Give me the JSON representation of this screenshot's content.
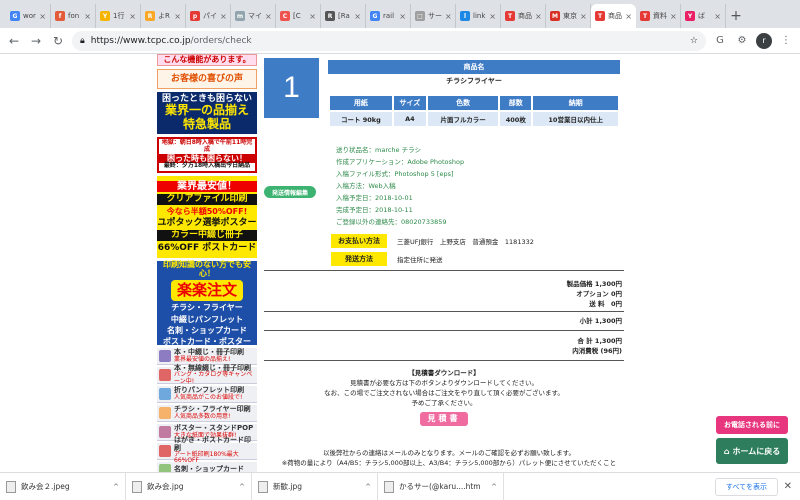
{
  "browser": {
    "tabs": [
      {
        "label": "wor",
        "color": "#4285f4",
        "glyph": "G"
      },
      {
        "label": "fon",
        "color": "#e25c3b",
        "glyph": "f"
      },
      {
        "label": "1行",
        "color": "#f4b400",
        "glyph": "Y"
      },
      {
        "label": "よR",
        "color": "#f9a825",
        "glyph": "R"
      },
      {
        "label": "パイ",
        "color": "#e53935",
        "glyph": "p"
      },
      {
        "label": "マイ",
        "color": "#90a4ae",
        "glyph": "m"
      },
      {
        "label": "[C",
        "color": "#ef5350",
        "glyph": "C"
      },
      {
        "label": "[Ra",
        "color": "#555555",
        "glyph": "R"
      },
      {
        "label": "rail",
        "color": "#4285f4",
        "glyph": "G"
      },
      {
        "label": "サー",
        "color": "#9e9e9e",
        "glyph": "□"
      },
      {
        "label": "link",
        "color": "#1e88e5",
        "glyph": "l"
      },
      {
        "label": "商品",
        "color": "#e53935",
        "glyph": "T"
      },
      {
        "label": "東京",
        "color": "#d93025",
        "glyph": "M"
      },
      {
        "label": "商品",
        "color": "#e53935",
        "glyph": "T",
        "active": true
      },
      {
        "label": "資料",
        "color": "#e53935",
        "glyph": "T"
      },
      {
        "label": "ば",
        "color": "#e91e63",
        "glyph": "Y"
      }
    ],
    "url_host": "https://www.tcpc.co.jp",
    "url_path": "/orders/check",
    "avatar_letter": "r"
  },
  "sidebar": {
    "banner_top": "こんな機能があります。",
    "banner_voice": "お客様の喜びの声",
    "banner_trouble_line1": "困ったときも困らない",
    "banner_trouble_line2": "業界一の品揃え 特急製品",
    "banner_quick_line1": "地獄：朝日8時入稿で午前11時完成",
    "banner_quick_line2": "困った時も困らない！",
    "banner_quick_line3": "最終：夕方18時入稿出今日納品",
    "cheap_line1": "業界最安値！",
    "cheap_line2": "クリアファイル印刷",
    "cheap_line3": "今なら半額50%OFF!",
    "cheap_line4": "ユポタック選挙ポスター",
    "cheap_line5": "カラー中綴じ冊子",
    "cheap_line6": "66%OFF ポストカード",
    "safe_line1": "印刷知識のない方でも安心！",
    "safe_big": "楽楽注文",
    "safe_line2": "チラシ・フライヤー",
    "safe_line3": "中綴じパンフレット",
    "safe_line4": "名刺・ショップカード",
    "safe_line5": "ポストカード・ポスター",
    "items": [
      {
        "title": "本・中綴じ・冊子印刷",
        "sub": "業界最安値の品揃え!",
        "color": "#8e7cc3"
      },
      {
        "title": "本・無線綴じ・冊子印刷",
        "sub": "バング・カタログ等キャンペーン中!",
        "color": "#e06666"
      },
      {
        "title": "折りパンフレット印刷",
        "sub": "人気商品がこのお値段で!",
        "color": "#6fa8dc"
      },
      {
        "title": "チラシ・フライヤー印刷",
        "sub": "人気商品多数の用意!",
        "color": "#f6b26b"
      },
      {
        "title": "ポスター・スタンドPOP",
        "sub": "大きな紙面で効果抜群!",
        "color": "#c27ba0"
      },
      {
        "title": "はがき・ポストカード印刷",
        "sub": "アート紙印刷180%最大66%OFF",
        "color": "#e06666"
      },
      {
        "title": "名刺・ショップカード",
        "sub": "",
        "color": "#93c47d"
      }
    ],
    "addr_edit_label": "発送情報編集"
  },
  "order": {
    "number": "1",
    "product_header": "商品名",
    "product_name": "チラシフライヤー",
    "spec_headers": [
      "用紙",
      "サイズ",
      "色数",
      "部数",
      "納期"
    ],
    "spec_values": [
      "コート 90kg",
      "A4",
      "片面フルカラー",
      "400枚",
      "10営業日以内仕上"
    ],
    "details": [
      "送り状品名：marche チラシ",
      "作成アプリケーション：Adobe Photoshop",
      "入稿ファイル形式：Photoshop 5 [eps]",
      "入稿方法：Web入稿",
      "入稿予定日：2018-10-01",
      "完成予定日：2018-10-11",
      "ご登録以外の連絡先：08020733859"
    ],
    "payment_label": "お支払い方法",
    "payment_value": "三菱UFJ銀行　上野支店　普通預金　1181332",
    "shipping_label": "発送方法",
    "shipping_value": "指定住所に発送"
  },
  "totals": {
    "price_line": "製品価格 1,300円",
    "option_line": "オプション 0円",
    "shipping_line": "送 料　0円",
    "subtotal_line": "小計 1,300円",
    "total_line": "合 計 1,300円",
    "tax_line": "内消費税 (96円)"
  },
  "estimate": {
    "title": "【見積書ダウンロード】",
    "line1": "見積書が必要な方は下のボタンよりダウンロードしてください。",
    "line2": "なお、この場でご注文されない場合はご注文をやり直して頂く必要がございます。",
    "line3": "予めご了承ください。",
    "button": "見積書"
  },
  "footer": {
    "line1": "以後弊社からの連絡はメールのみとなります。メールのご確認を必ずお願い致します。",
    "line2": "※荷物の量により（A4/B5：チラシ5,000部以上、A3/B4：チラシ5,000部から）パレット便にさせていただくこと"
  },
  "floating": {
    "phone": "お電話される前に",
    "home": "ホームに戻る"
  },
  "downloads": {
    "items": [
      "飲み会２.jpeg",
      "飲み会.jpg",
      "新歓.jpg",
      "かるサー(@karu....htm"
    ],
    "show_all": "すべてを表示"
  }
}
